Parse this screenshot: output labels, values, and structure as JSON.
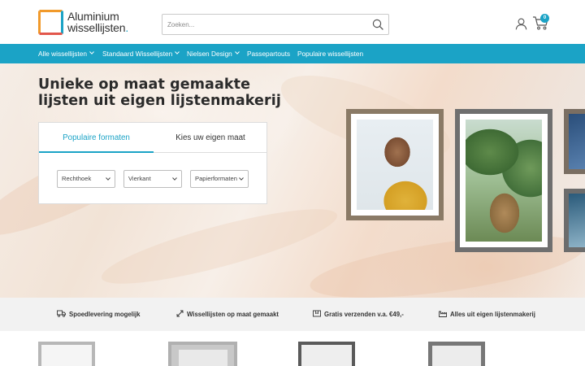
{
  "header": {
    "logo_line1": "Aluminium",
    "logo_line2": "wissellijsten",
    "logo_dot": ".",
    "search_placeholder": "Zoeken...",
    "cart_count": "0"
  },
  "nav": {
    "items": [
      {
        "label": "Alle wissellijsten",
        "has_dropdown": true
      },
      {
        "label": "Standaard Wissellijsten",
        "has_dropdown": true
      },
      {
        "label": "Nielsen Design",
        "has_dropdown": true
      },
      {
        "label": "Passepartouts",
        "has_dropdown": false
      },
      {
        "label": "Populaire wissellijsten",
        "has_dropdown": false
      }
    ]
  },
  "hero": {
    "title_line1": "Unieke op maat gemaakte",
    "title_line2": "lijsten uit eigen lijstenmakerij",
    "tabs": [
      {
        "label": "Populaire formaten",
        "active": true
      },
      {
        "label": "Kies uw eigen maat",
        "active": false
      }
    ],
    "selects": [
      {
        "value": "Rechthoek"
      },
      {
        "value": "Vierkant"
      },
      {
        "value": "Papierformaten"
      }
    ]
  },
  "usps": [
    {
      "label": "Spoedlevering mogelijk",
      "icon": "truck-icon"
    },
    {
      "label": "Wissellijsten op maat gemaakt",
      "icon": "resize-arrows-icon"
    },
    {
      "label": "Gratis verzenden v.a. €49,-",
      "icon": "package-icon"
    },
    {
      "label": "Alles uit eigen lijstenmakerij",
      "icon": "factory-icon"
    }
  ],
  "colors": {
    "accent": "#1ba3c6",
    "usp_bg": "#f2f2f2",
    "text": "#2b2b2b"
  }
}
